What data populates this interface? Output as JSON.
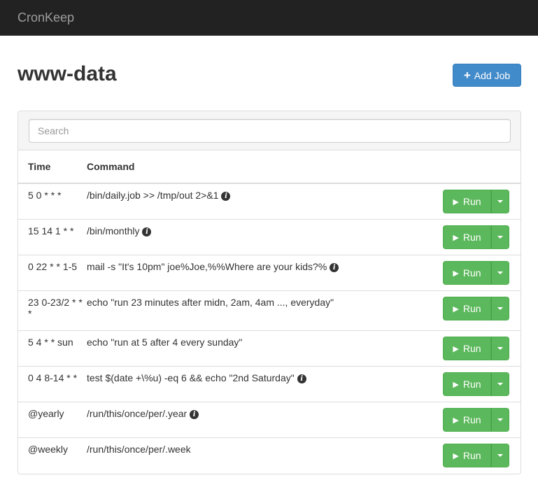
{
  "app": {
    "brand": "CronKeep"
  },
  "page": {
    "title": "www-data",
    "add_button_label": "Add Job"
  },
  "search": {
    "placeholder": "Search",
    "value": ""
  },
  "table": {
    "headers": {
      "time": "Time",
      "command": "Command"
    },
    "run_label": "Run",
    "rows": [
      {
        "time": "5 0 * * *",
        "command": "/bin/daily.job >> /tmp/out 2>&1",
        "info": true
      },
      {
        "time": "15 14 1 * *",
        "command": "/bin/monthly",
        "info": true
      },
      {
        "time": "0 22 * * 1-5",
        "command": "mail -s \"It's 10pm\" joe%Joe,%%Where are your kids?%",
        "info": true
      },
      {
        "time": "23 0-23/2 * * *",
        "command": "echo \"run 23 minutes after midn, 2am, 4am ..., everyday\"",
        "info": false
      },
      {
        "time": "5 4 * * sun",
        "command": "echo \"run at 5 after 4 every sunday\"",
        "info": false
      },
      {
        "time": "0 4 8-14 * *",
        "command": "test $(date +\\%u) -eq 6 && echo \"2nd Saturday\"",
        "info": true
      },
      {
        "time": "@yearly",
        "command": "/run/this/once/per/.year",
        "info": true
      },
      {
        "time": "@weekly",
        "command": "/run/this/once/per/.week",
        "info": false
      }
    ]
  },
  "colors": {
    "navbar": "#222222",
    "primary": "#428bca",
    "success": "#5cb85c"
  }
}
